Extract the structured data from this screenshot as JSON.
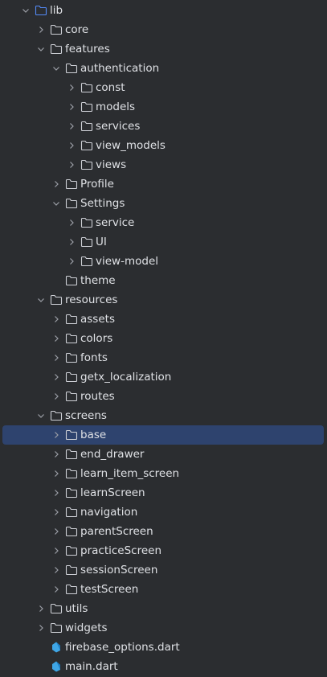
{
  "colors": {
    "background": "#2b2d30",
    "selection": "#2e436e",
    "text": "#dfe1e5",
    "folder": "#ced0d6",
    "source_folder": "#548af7",
    "dart": "#3fa6e6"
  },
  "tree": [
    {
      "label": "lib",
      "depth": 0,
      "kind": "source-folder",
      "state": "expanded"
    },
    {
      "label": "core",
      "depth": 1,
      "kind": "folder",
      "state": "collapsed"
    },
    {
      "label": "features",
      "depth": 1,
      "kind": "folder",
      "state": "expanded"
    },
    {
      "label": "authentication",
      "depth": 2,
      "kind": "folder",
      "state": "expanded"
    },
    {
      "label": "const",
      "depth": 3,
      "kind": "folder",
      "state": "collapsed"
    },
    {
      "label": "models",
      "depth": 3,
      "kind": "folder",
      "state": "collapsed"
    },
    {
      "label": "services",
      "depth": 3,
      "kind": "folder",
      "state": "collapsed"
    },
    {
      "label": "view_models",
      "depth": 3,
      "kind": "folder",
      "state": "collapsed"
    },
    {
      "label": "views",
      "depth": 3,
      "kind": "folder",
      "state": "collapsed"
    },
    {
      "label": "Profile",
      "depth": 2,
      "kind": "folder",
      "state": "collapsed"
    },
    {
      "label": "Settings",
      "depth": 2,
      "kind": "folder",
      "state": "expanded"
    },
    {
      "label": "service",
      "depth": 3,
      "kind": "folder",
      "state": "collapsed"
    },
    {
      "label": "UI",
      "depth": 3,
      "kind": "folder",
      "state": "collapsed"
    },
    {
      "label": "view-model",
      "depth": 3,
      "kind": "folder",
      "state": "collapsed"
    },
    {
      "label": "theme",
      "depth": 2,
      "kind": "folder",
      "state": "leaf"
    },
    {
      "label": "resources",
      "depth": 1,
      "kind": "folder",
      "state": "expanded"
    },
    {
      "label": "assets",
      "depth": 2,
      "kind": "folder",
      "state": "collapsed"
    },
    {
      "label": "colors",
      "depth": 2,
      "kind": "folder",
      "state": "collapsed"
    },
    {
      "label": "fonts",
      "depth": 2,
      "kind": "folder",
      "state": "collapsed"
    },
    {
      "label": "getx_localization",
      "depth": 2,
      "kind": "folder",
      "state": "collapsed"
    },
    {
      "label": "routes",
      "depth": 2,
      "kind": "folder",
      "state": "collapsed"
    },
    {
      "label": "screens",
      "depth": 1,
      "kind": "folder",
      "state": "expanded"
    },
    {
      "label": "base",
      "depth": 2,
      "kind": "folder",
      "state": "collapsed",
      "selected": true
    },
    {
      "label": "end_drawer",
      "depth": 2,
      "kind": "folder",
      "state": "collapsed"
    },
    {
      "label": "learn_item_screen",
      "depth": 2,
      "kind": "folder",
      "state": "collapsed"
    },
    {
      "label": "learnScreen",
      "depth": 2,
      "kind": "folder",
      "state": "collapsed"
    },
    {
      "label": "navigation",
      "depth": 2,
      "kind": "folder",
      "state": "collapsed"
    },
    {
      "label": "parentScreen",
      "depth": 2,
      "kind": "folder",
      "state": "collapsed"
    },
    {
      "label": "practiceScreen",
      "depth": 2,
      "kind": "folder",
      "state": "collapsed"
    },
    {
      "label": "sessionScreen",
      "depth": 2,
      "kind": "folder",
      "state": "collapsed"
    },
    {
      "label": "testScreen",
      "depth": 2,
      "kind": "folder",
      "state": "collapsed"
    },
    {
      "label": "utils",
      "depth": 1,
      "kind": "folder",
      "state": "collapsed"
    },
    {
      "label": "widgets",
      "depth": 1,
      "kind": "folder",
      "state": "collapsed"
    },
    {
      "label": "firebase_options.dart",
      "depth": 1,
      "kind": "dart-file",
      "state": "leaf"
    },
    {
      "label": "main.dart",
      "depth": 1,
      "kind": "dart-file",
      "state": "leaf"
    }
  ]
}
